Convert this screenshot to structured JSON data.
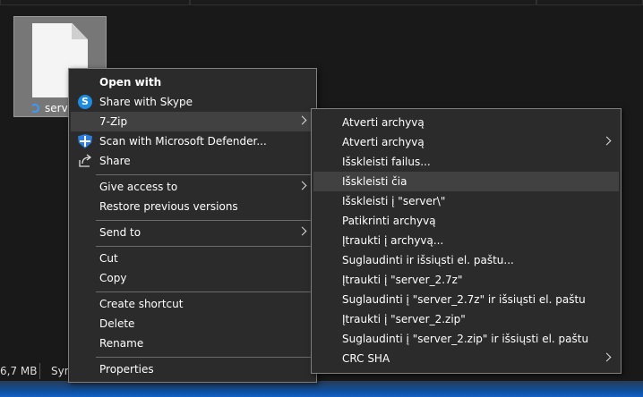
{
  "file": {
    "name": "server"
  },
  "status_bar": {
    "size": "6,7 MB",
    "sync": "Syn"
  },
  "context_menu": {
    "open_with": "Open with",
    "share_with_skype": "Share with Skype",
    "seven_zip": "7-Zip",
    "scan_defender": "Scan with Microsoft Defender...",
    "share": "Share",
    "give_access_to": "Give access to",
    "restore_previous": "Restore previous versions",
    "send_to": "Send to",
    "cut": "Cut",
    "copy": "Copy",
    "create_shortcut": "Create shortcut",
    "delete": "Delete",
    "rename": "Rename",
    "properties": "Properties"
  },
  "submenu": {
    "items": [
      "Atverti archyvą",
      "Atverti archyvą",
      "Išskleisti failus...",
      "Išskleisti čia",
      "Išskleisti į \"server\\\"",
      "Patikrinti archyvą",
      "Įtraukti į archyvą...",
      "Suglaudinti ir išsiųsti el. paštu...",
      "Įtraukti į \"server_2.7z\"",
      "Suglaudinti į \"server_2.7z\" ir išsiųsti el. paštu",
      "Įtraukti į \"server_2.zip\"",
      "Suglaudinti į \"server_2.zip\" ir išsiųsti el. paštu",
      "CRC SHA"
    ]
  },
  "icons": {
    "skype": "skype-icon",
    "defender": "defender-shield-icon",
    "share": "share-icon",
    "submenu_arrow": "chevron-right-icon"
  },
  "colors": {
    "menu_bg": "#2b2b2b",
    "menu_highlight": "#414141",
    "skype_blue": "#1e8be0",
    "desktop_bg": "#191919"
  }
}
